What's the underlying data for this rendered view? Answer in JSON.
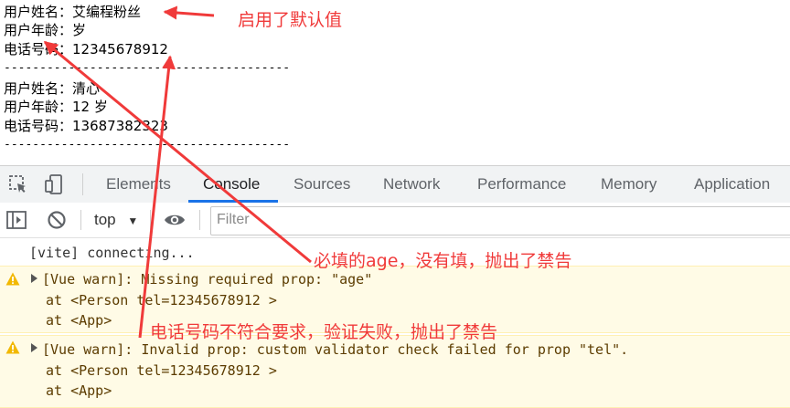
{
  "page": {
    "user1": {
      "name_line": "用户姓名：艾编程粉丝",
      "age_line": "用户年龄：岁",
      "tel_line": "电话号码：12345678912"
    },
    "divider": "----------------------------------------",
    "user2": {
      "name_line": "用户姓名：清心",
      "age_line": "用户年龄：12 岁",
      "tel_line": "电话号码：13687382323"
    }
  },
  "devtools": {
    "tabs": [
      "Elements",
      "Console",
      "Sources",
      "Network",
      "Performance",
      "Memory",
      "Application"
    ],
    "active_tab": "Console",
    "context": "top",
    "filter_placeholder": "Filter",
    "icons": [
      "inspect-element-icon",
      "device-toolbar-icon",
      "sidebar-toggle-icon",
      "clear-console-icon",
      "dropdown-arrow-icon",
      "eye-icon",
      "warning-icon"
    ],
    "accent_color": "#1a73e8"
  },
  "console": {
    "connecting": "[vite] connecting...",
    "warnings": [
      {
        "message": "[Vue warn]: Missing required prop: \"age\"",
        "trace": [
          "at <Person tel=12345678912 >",
          "at <App>"
        ]
      },
      {
        "message": "[Vue warn]: Invalid prop: custom validator check failed for prop \"tel\".",
        "trace": [
          "at <Person tel=12345678912 >",
          "at <App>"
        ]
      }
    ]
  },
  "annotations": {
    "default_value": "启用了默认值",
    "age_required": "必填的age，没有填，抛出了禁告",
    "tel_invalid": "电话号码不符合要求，验证失败，抛出了禁告",
    "color": "#f03a3a"
  }
}
